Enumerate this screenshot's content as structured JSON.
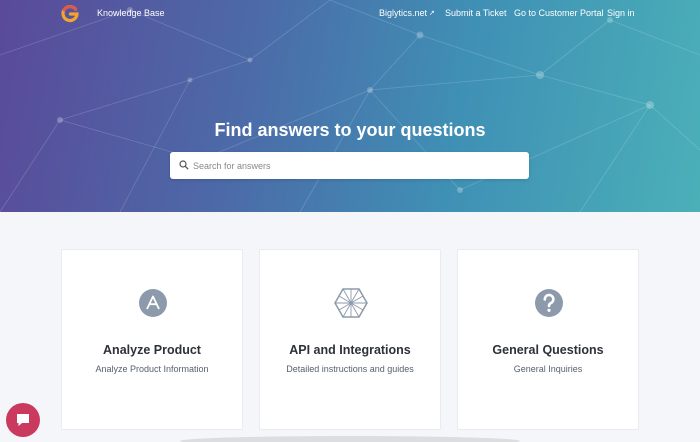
{
  "header": {
    "brand": "Knowledge Base",
    "nav": {
      "biglytics": "Biglytics.net",
      "submit": "Submit a Ticket",
      "portal": "Go to Customer Portal",
      "signin": "Sign in"
    }
  },
  "hero": {
    "heading": "Find answers to your questions",
    "search_placeholder": "Search for answers"
  },
  "categories": [
    {
      "title": "Analyze Product",
      "desc": "Analyze Product Information",
      "icon": "analyze-product-icon"
    },
    {
      "title": "API and Integrations",
      "desc": "Detailed instructions and guides",
      "icon": "api-integrations-icon"
    },
    {
      "title": "General Questions",
      "desc": "General Inquiries",
      "icon": "question-icon"
    }
  ],
  "colors": {
    "hero_left": "#5a4a99",
    "hero_right": "#4bb0b8",
    "icon_gray": "#8d9aab",
    "chat": "#c93a5e"
  }
}
